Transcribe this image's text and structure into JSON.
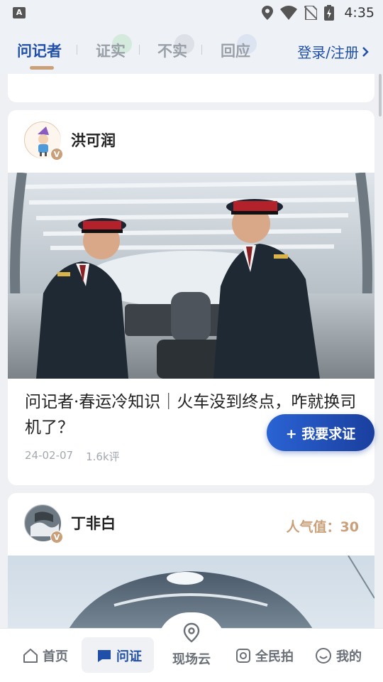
{
  "status_bar": {
    "time": "4:35",
    "left_badge": "A"
  },
  "top_nav": {
    "tabs": [
      {
        "label": "问记者"
      },
      {
        "label": "证实"
      },
      {
        "label": "不实"
      },
      {
        "label": "回应"
      }
    ],
    "login_label": "登录/注册"
  },
  "cards": [
    {
      "author": "洪可润",
      "badge": "V",
      "headline": "问记者·春运冷知识｜火车没到终点，咋就换司机了？",
      "date": "24-02-07",
      "comments": "1.6k评"
    },
    {
      "author": "丁非白",
      "badge": "V",
      "popularity_label": "人气值：",
      "popularity_value": "30"
    }
  ],
  "fab_label": "+ 我要求证",
  "bottom_nav": {
    "items": [
      {
        "label": "首页"
      },
      {
        "label": "问证"
      },
      {
        "label": "现场云"
      },
      {
        "label": "全民拍"
      },
      {
        "label": "我的"
      }
    ]
  },
  "colors": {
    "accent": "#1f4fa8",
    "gold": "#c9a07a"
  }
}
